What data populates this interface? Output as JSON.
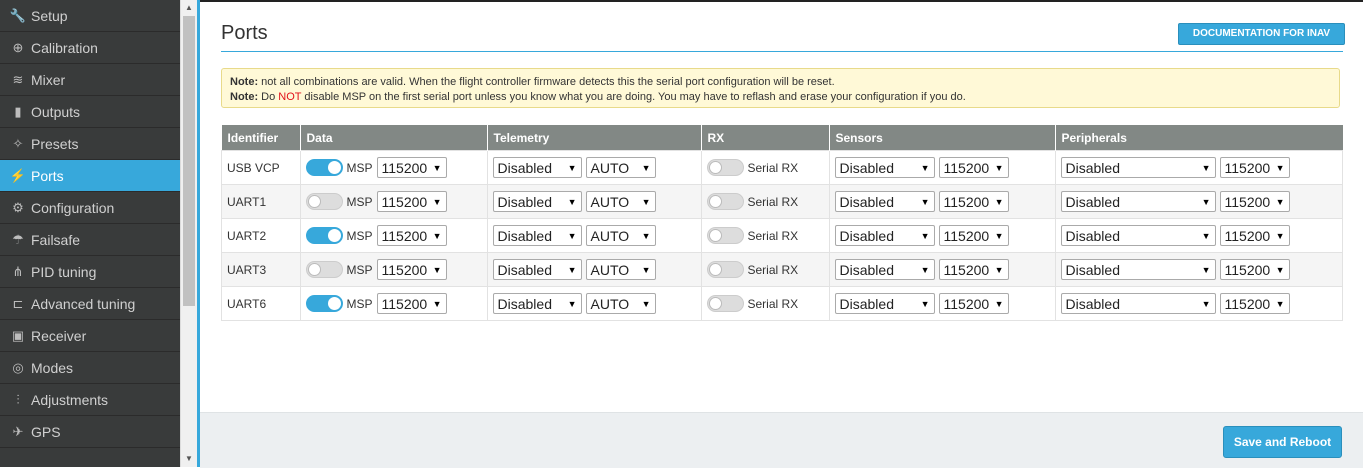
{
  "sidebar": {
    "items": [
      {
        "label": "Setup",
        "icon": "wrench-icon",
        "active": false
      },
      {
        "label": "Calibration",
        "icon": "crosshair-icon",
        "active": false
      },
      {
        "label": "Mixer",
        "icon": "mixer-icon",
        "active": false
      },
      {
        "label": "Outputs",
        "icon": "motor-icon",
        "active": false
      },
      {
        "label": "Presets",
        "icon": "magic-wand-icon",
        "active": false
      },
      {
        "label": "Ports",
        "icon": "plug-icon",
        "active": true
      },
      {
        "label": "Configuration",
        "icon": "gear-icon",
        "active": false
      },
      {
        "label": "Failsafe",
        "icon": "parachute-icon",
        "active": false
      },
      {
        "label": "PID tuning",
        "icon": "pid-icon",
        "active": false
      },
      {
        "label": "Advanced tuning",
        "icon": "advanced-tuning-icon",
        "active": false
      },
      {
        "label": "Receiver",
        "icon": "receiver-icon",
        "active": false
      },
      {
        "label": "Modes",
        "icon": "modes-icon",
        "active": false
      },
      {
        "label": "Adjustments",
        "icon": "sliders-icon",
        "active": false
      },
      {
        "label": "GPS",
        "icon": "satellite-icon",
        "active": false
      }
    ]
  },
  "header": {
    "title": "Ports",
    "doc_button": "DOCUMENTATION FOR INAV"
  },
  "notes": {
    "line1_strong": "Note:",
    "line1_text": " not all combinations are valid. When the flight controller firmware detects this the serial port configuration will be reset.",
    "line2_strong": "Note:",
    "line2_pre": " Do ",
    "line2_red": "NOT",
    "line2_post": " disable MSP on the first serial port unless you know what you are doing. You may have to reflash and erase your configuration if you do."
  },
  "table": {
    "headers": [
      "Identifier",
      "Data",
      "Telemetry",
      "RX",
      "Sensors",
      "Peripherals"
    ],
    "msp_label": "MSP",
    "rx_label": "Serial RX",
    "rows": [
      {
        "id": "USB VCP",
        "msp_on": true,
        "msp_baud": "115200",
        "telemetry": "Disabled",
        "telemetry_baud": "AUTO",
        "rx_on": false,
        "sensors": "Disabled",
        "sensors_baud": "115200",
        "peripherals": "Disabled",
        "peripherals_baud": "115200"
      },
      {
        "id": "UART1",
        "msp_on": false,
        "msp_baud": "115200",
        "telemetry": "Disabled",
        "telemetry_baud": "AUTO",
        "rx_on": false,
        "sensors": "Disabled",
        "sensors_baud": "115200",
        "peripherals": "Disabled",
        "peripherals_baud": "115200"
      },
      {
        "id": "UART2",
        "msp_on": true,
        "msp_baud": "115200",
        "telemetry": "Disabled",
        "telemetry_baud": "AUTO",
        "rx_on": false,
        "sensors": "Disabled",
        "sensors_baud": "115200",
        "peripherals": "Disabled",
        "peripherals_baud": "115200"
      },
      {
        "id": "UART3",
        "msp_on": false,
        "msp_baud": "115200",
        "telemetry": "Disabled",
        "telemetry_baud": "AUTO",
        "rx_on": false,
        "sensors": "Disabled",
        "sensors_baud": "115200",
        "peripherals": "Disabled",
        "peripherals_baud": "115200"
      },
      {
        "id": "UART6",
        "msp_on": true,
        "msp_baud": "115200",
        "telemetry": "Disabled",
        "telemetry_baud": "AUTO",
        "rx_on": false,
        "sensors": "Disabled",
        "sensors_baud": "115200",
        "peripherals": "Disabled",
        "peripherals_baud": "115200"
      }
    ]
  },
  "footer": {
    "save_button": "Save and Reboot"
  },
  "colors": {
    "accent": "#37a8db",
    "sidebar_bg": "#393b3b",
    "table_header_bg": "#828885",
    "note_bg": "#fff9d7",
    "note_red": "#e2131b"
  }
}
